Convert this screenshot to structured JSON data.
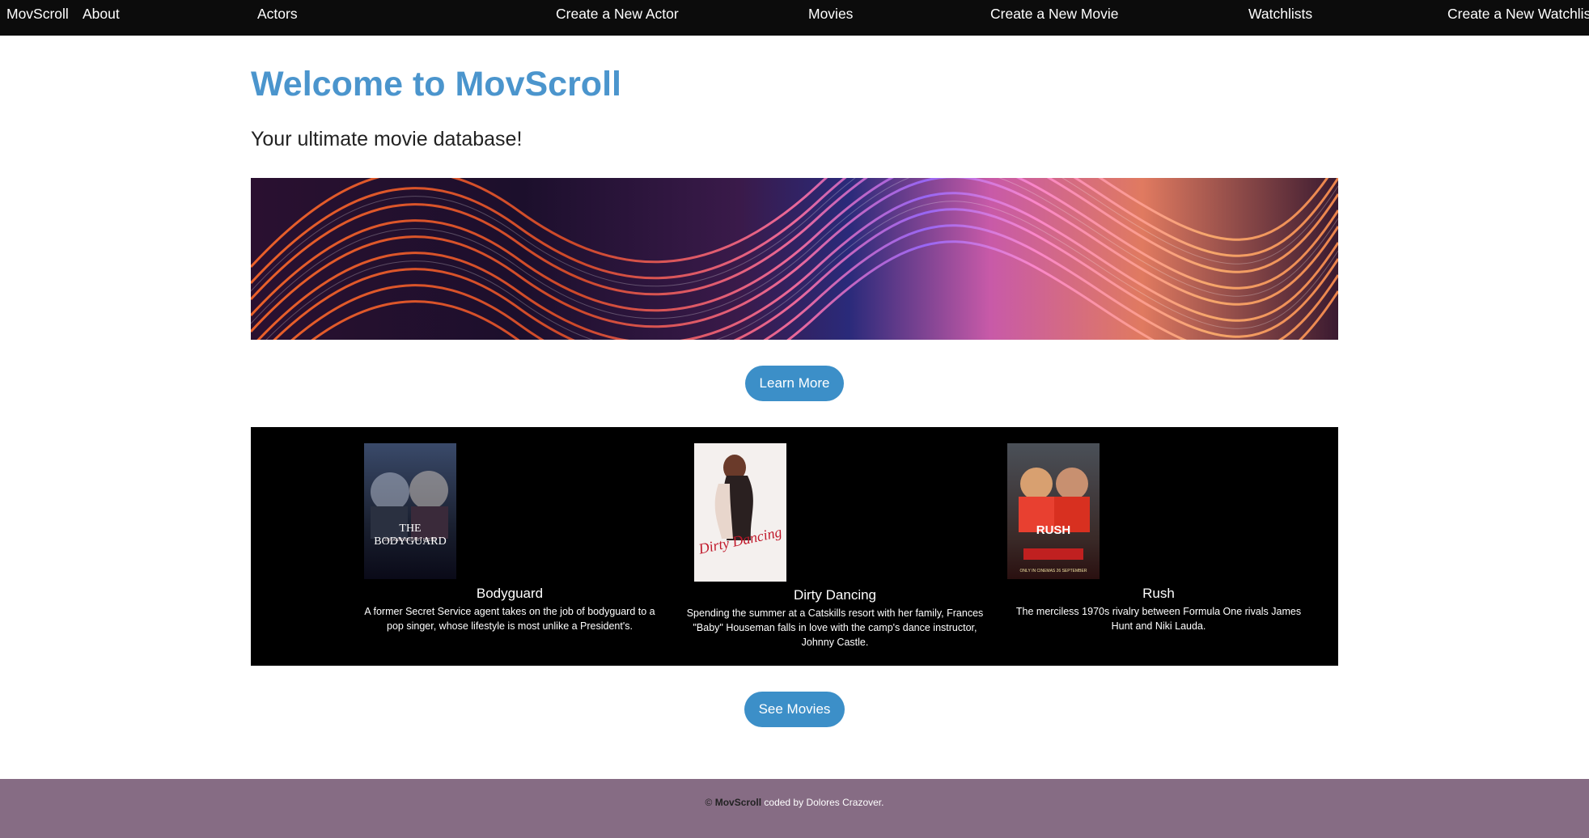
{
  "nav": {
    "brand": "MovScroll",
    "items": [
      {
        "label": "About"
      },
      {
        "label": "Actors"
      },
      {
        "label": "Create a New Actor"
      },
      {
        "label": "Movies"
      },
      {
        "label": "Create a New Movie"
      },
      {
        "label": "Watchlists"
      },
      {
        "label": "Create a New Watchlist"
      }
    ]
  },
  "hero": {
    "title": "Welcome to MovScroll",
    "subtitle": "Your ultimate movie database!",
    "learn_more": "Learn More"
  },
  "movies": [
    {
      "title": "Bodyguard",
      "description": "A former Secret Service agent takes on the job of bodyguard to a pop singer, whose lifestyle is most unlike a President's.",
      "poster_text": "THE BODYGUARD",
      "poster_subtext": "25th ANNIVERSARY EVENT"
    },
    {
      "title": "Dirty Dancing",
      "description": "Spending the summer at a Catskills resort with her family, Frances \"Baby\" Houseman falls in love with the camp's dance instructor, Johnny Castle.",
      "poster_text": "Dirty Dancing"
    },
    {
      "title": "Rush",
      "description": "The merciless 1970s rivalry between Formula One rivals James Hunt and Niki Lauda.",
      "poster_text": "RUSH",
      "poster_subtext": "ONLY IN CINEMAS 26 SEPTEMBER"
    }
  ],
  "see_movies": "See Movies",
  "footer": {
    "copyright": "©",
    "brand": "MovScroll",
    "credit": "coded by Dolores Crazover."
  },
  "colors": {
    "nav_bg": "#0c0c0c",
    "accent": "#3c8fc8",
    "title": "#4b95cd",
    "footer_bg": "#866c84"
  }
}
